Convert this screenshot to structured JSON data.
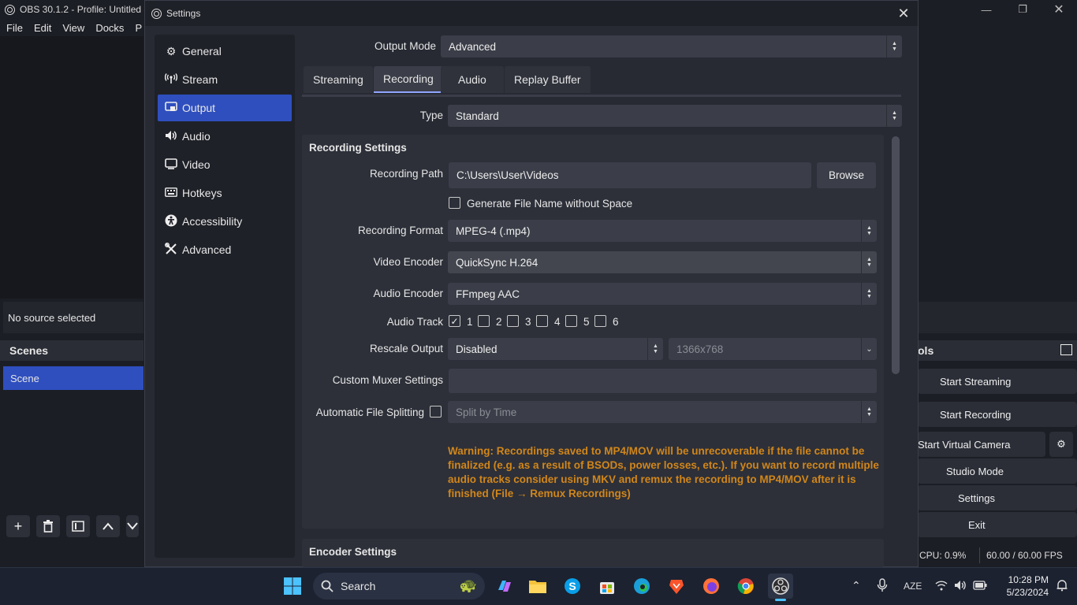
{
  "main_window": {
    "title": "OBS 30.1.2 - Profile: Untitled -",
    "menu": [
      "File",
      "Edit",
      "View",
      "Docks",
      "P"
    ],
    "no_source": "No source selected",
    "scenes_header": "Scenes",
    "scenes": [
      "Scene"
    ],
    "controls_header": "ols",
    "controls": [
      "Start Streaming",
      "Start Recording",
      "Start Virtual Camera",
      "Studio Mode",
      "Settings",
      "Exit"
    ],
    "cpu": "CPU: 0.9%",
    "fps": "60.00 / 60.00 FPS"
  },
  "dialog": {
    "title": "Settings",
    "sidebar": [
      {
        "label": "General",
        "icon": "gear-icon"
      },
      {
        "label": "Stream",
        "icon": "antenna-icon"
      },
      {
        "label": "Output",
        "icon": "output-icon",
        "active": true
      },
      {
        "label": "Audio",
        "icon": "speaker-icon"
      },
      {
        "label": "Video",
        "icon": "monitor-icon"
      },
      {
        "label": "Hotkeys",
        "icon": "keyboard-icon"
      },
      {
        "label": "Accessibility",
        "icon": "accessibility-icon"
      },
      {
        "label": "Advanced",
        "icon": "tools-icon"
      }
    ],
    "output_mode_label": "Output Mode",
    "output_mode": "Advanced",
    "tabs": [
      "Streaming",
      "Recording",
      "Audio",
      "Replay Buffer"
    ],
    "active_tab": "Recording",
    "type_label": "Type",
    "type_value": "Standard",
    "recording_settings_title": "Recording Settings",
    "recording_path_label": "Recording Path",
    "recording_path": "C:\\Users\\User\\Videos",
    "browse": "Browse",
    "gen_filename_label": "Generate File Name without Space",
    "gen_filename_checked": false,
    "format_label": "Recording Format",
    "format_value": "MPEG-4 (.mp4)",
    "video_encoder_label": "Video Encoder",
    "video_encoder": "QuickSync H.264",
    "audio_encoder_label": "Audio Encoder",
    "audio_encoder": "FFmpeg AAC",
    "audio_track_label": "Audio Track",
    "audio_tracks": [
      {
        "n": "1",
        "checked": true
      },
      {
        "n": "2",
        "checked": false
      },
      {
        "n": "3",
        "checked": false
      },
      {
        "n": "4",
        "checked": false
      },
      {
        "n": "5",
        "checked": false
      },
      {
        "n": "6",
        "checked": false
      }
    ],
    "rescale_label": "Rescale Output",
    "rescale_value": "Disabled",
    "rescale_res": "1366x768",
    "muxer_label": "Custom Muxer Settings",
    "muxer_value": "",
    "split_label": "Automatic File Splitting",
    "split_checked": false,
    "split_value": "Split by Time",
    "warning": "Warning: Recordings saved to MP4/MOV will be unrecoverable if the file cannot be finalized (e.g. as a result of BSODs, power losses, etc.). If you want to record multiple audio tracks consider using MKV and remux the recording to MP4/MOV after it is finished (File → Remux Recordings)",
    "encoder_settings_title": "Encoder Settings"
  },
  "taskbar": {
    "search_label": "Search",
    "language": "AZE",
    "time": "10:28 PM",
    "date": "5/23/2024"
  },
  "colors": {
    "accent": "#2f4fbf",
    "warning": "#d1861a",
    "tab_underline": "#8fa5ff"
  }
}
